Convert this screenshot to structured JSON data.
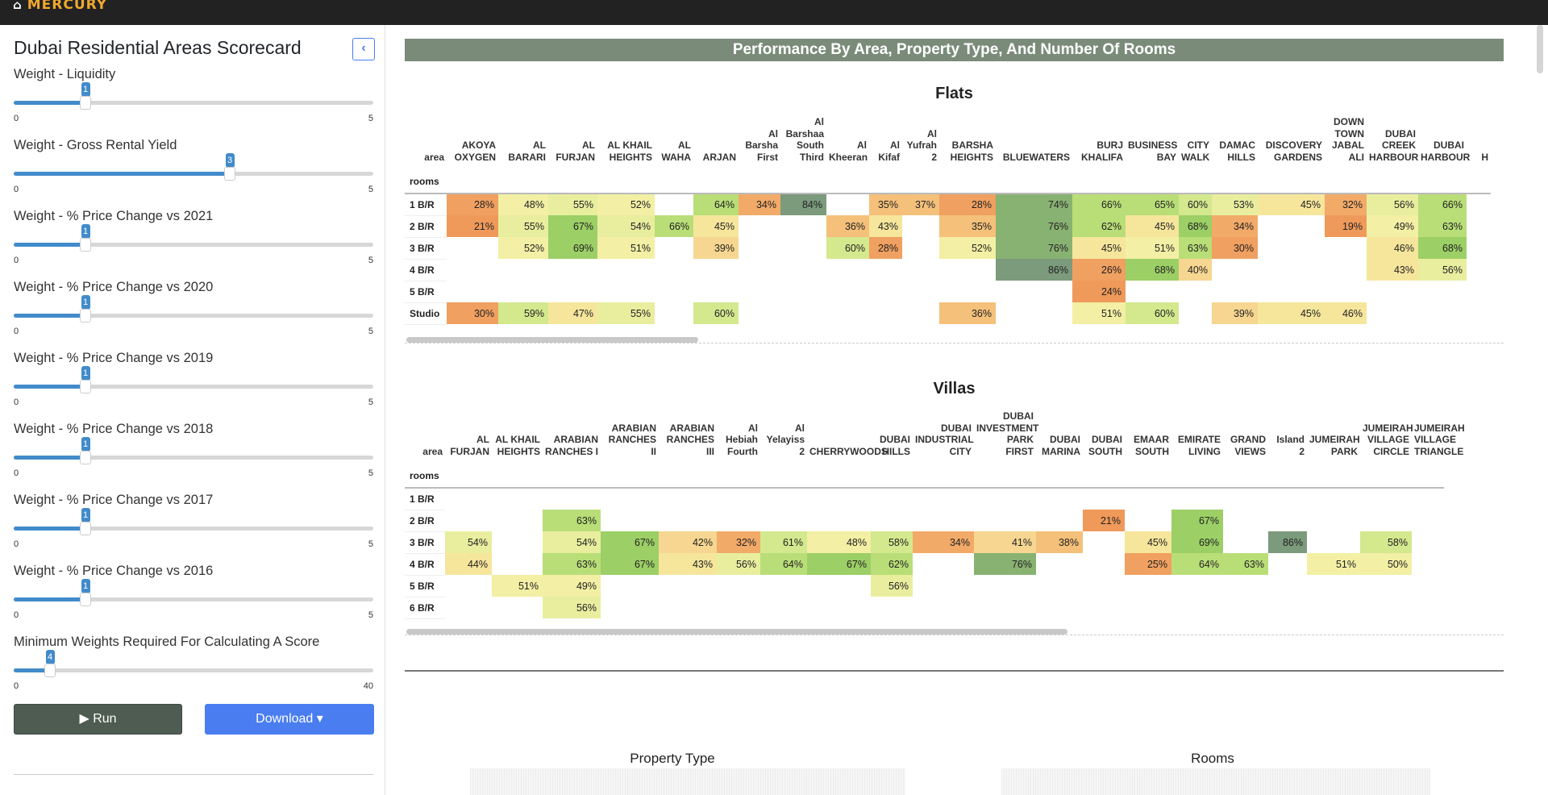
{
  "brand": {
    "name": "MERCURY",
    "home_icon": "home-icon"
  },
  "sidebar": {
    "title": "Dubai Residential Areas Scorecard",
    "collapse_icon": "chevron-left-icon",
    "sliders": [
      {
        "label": "Weight - Liquidity",
        "value": 1,
        "min": "0",
        "max": "5"
      },
      {
        "label": "Weight - Gross Rental Yield",
        "value": 3,
        "min": "0",
        "max": "5"
      },
      {
        "label": "Weight - % Price Change vs 2021",
        "value": 1,
        "min": "0",
        "max": "5"
      },
      {
        "label": "Weight - % Price Change vs 2020",
        "value": 1,
        "min": "0",
        "max": "5"
      },
      {
        "label": "Weight - % Price Change vs 2019",
        "value": 1,
        "min": "0",
        "max": "5"
      },
      {
        "label": "Weight - % Price Change vs 2018",
        "value": 1,
        "min": "0",
        "max": "5"
      },
      {
        "label": "Weight - % Price Change vs 2017",
        "value": 1,
        "min": "0",
        "max": "5"
      },
      {
        "label": "Weight - % Price Change vs 2016",
        "value": 1,
        "min": "0",
        "max": "5"
      },
      {
        "label": "Minimum Weights Required For Calculating A Score",
        "value": 4,
        "min": "0",
        "max": "40"
      }
    ],
    "run_label": "▶ Run",
    "download_label": "Download ▾"
  },
  "main": {
    "banner": "Performance By Area, Property Type, And Number Of Rooms",
    "flats": {
      "title": "Flats",
      "area_label": "area",
      "rooms_label": "rooms",
      "areas": [
        "AKOYA OXYGEN",
        "AL BARARI",
        "AL FURJAN",
        "AL KHAIL HEIGHTS",
        "AL WAHA",
        "ARJAN",
        "Al Barsha First",
        "Al Barshaa South Third",
        "Al Kheeran",
        "Al Kifaf",
        "Al Yufrah 2",
        "BARSHA HEIGHTS",
        "BLUEWATERS",
        "BURJ KHALIFA",
        "BUSINESS BAY",
        "CITY WALK",
        "DAMAC HILLS",
        "DISCOVERY GARDENS",
        "DOWN TOWN JABAL ALI",
        "DUBAI CREEK HARBOUR",
        "DUBAI HARBOUR",
        "H"
      ],
      "rows": [
        {
          "room": "1 B/R",
          "cells": [
            "28%",
            "48%",
            "55%",
            "52%",
            "",
            "64%",
            "34%",
            "84%",
            "",
            "35%",
            "37%",
            "28%",
            "74%",
            "66%",
            "65%",
            "60%",
            "53%",
            "45%",
            "32%",
            "56%",
            "66%",
            ""
          ]
        },
        {
          "room": "2 B/R",
          "cells": [
            "21%",
            "55%",
            "67%",
            "54%",
            "66%",
            "45%",
            "",
            "",
            "36%",
            "43%",
            "",
            "35%",
            "76%",
            "62%",
            "45%",
            "68%",
            "34%",
            "",
            "19%",
            "49%",
            "63%",
            ""
          ]
        },
        {
          "room": "3 B/R",
          "cells": [
            "",
            "52%",
            "69%",
            "51%",
            "",
            "39%",
            "",
            "",
            "60%",
            "28%",
            "",
            "52%",
            "76%",
            "45%",
            "51%",
            "63%",
            "30%",
            "",
            "",
            "46%",
            "68%",
            ""
          ]
        },
        {
          "room": "4 B/R",
          "cells": [
            "",
            "",
            "",
            "",
            "",
            "",
            "",
            "",
            "",
            "",
            "",
            "",
            "86%",
            "26%",
            "68%",
            "40%",
            "",
            "",
            "",
            "43%",
            "56%",
            ""
          ]
        },
        {
          "room": "5 B/R",
          "cells": [
            "",
            "",
            "",
            "",
            "",
            "",
            "",
            "",
            "",
            "",
            "",
            "",
            "",
            "24%",
            "",
            "",
            "",
            "",
            "",
            "",
            "",
            ""
          ]
        },
        {
          "room": "Studio",
          "cells": [
            "30%",
            "59%",
            "47%",
            "55%",
            "",
            "60%",
            "",
            "",
            "",
            "",
            "",
            "36%",
            "",
            "51%",
            "60%",
            "",
            "39%",
            "45%",
            "46%",
            "",
            "",
            ""
          ]
        }
      ]
    },
    "villas": {
      "title": "Villas",
      "area_label": "area",
      "rooms_label": "rooms",
      "areas": [
        "AL FURJAN",
        "AL KHAIL HEIGHTS",
        "ARABIAN RANCHES I",
        "ARABIAN RANCHES II",
        "ARABIAN RANCHES III",
        "Al Hebiah Fourth",
        "Al Yelayiss 2",
        "CHERRYWOODS",
        "DUBAI HILLS",
        "DUBAI INDUSTRIAL CITY",
        "DUBAI INVESTMENT PARK FIRST",
        "DUBAI MARINA",
        "DUBAI SOUTH",
        "EMAAR SOUTH",
        "EMIRATE LIVING",
        "GRAND VIEWS",
        "Island 2",
        "JUMEIRAH PARK",
        "JUMEIRAH VILLAGE CIRCLE",
        "JUMEIRAH VILLAGE TRIANGLE"
      ],
      "rows": [
        {
          "room": "1 B/R",
          "cells": [
            "",
            "",
            "",
            "",
            "",
            "",
            "",
            "",
            "",
            "",
            "",
            "",
            "",
            "",
            "",
            "",
            "",
            "",
            "",
            ""
          ]
        },
        {
          "room": "2 B/R",
          "cells": [
            "",
            "",
            "63%",
            "",
            "",
            "",
            "",
            "",
            "",
            "",
            "",
            "",
            "21%",
            "",
            "67%",
            "",
            "",
            "",
            "",
            ""
          ]
        },
        {
          "room": "3 B/R",
          "cells": [
            "54%",
            "",
            "54%",
            "67%",
            "42%",
            "32%",
            "61%",
            "48%",
            "58%",
            "34%",
            "41%",
            "38%",
            "",
            "45%",
            "69%",
            "",
            "86%",
            "",
            "58%",
            ""
          ]
        },
        {
          "room": "4 B/R",
          "cells": [
            "44%",
            "",
            "63%",
            "67%",
            "43%",
            "56%",
            "64%",
            "67%",
            "62%",
            "",
            "76%",
            "",
            "",
            "25%",
            "64%",
            "63%",
            "",
            "51%",
            "50%",
            ""
          ]
        },
        {
          "room": "5 B/R",
          "cells": [
            "",
            "51%",
            "49%",
            "",
            "",
            "",
            "",
            "",
            "56%",
            "",
            "",
            "",
            "",
            "",
            "",
            "",
            "",
            "",
            "",
            ""
          ]
        },
        {
          "room": "6 B/R",
          "cells": [
            "",
            "",
            "56%",
            "",
            "",
            "",
            "",
            "",
            "",
            "",
            "",
            "",
            "",
            "",
            "",
            "",
            "",
            "",
            "",
            ""
          ]
        }
      ]
    },
    "charts": {
      "property_type_title": "Property Type",
      "rooms_title": "Rooms"
    }
  },
  "colors": {
    "c21": "#ef9a5a",
    "c28": "#f0a060",
    "c32": "#f2aa68",
    "c36": "#f4c07a",
    "c40": "#f6d690",
    "c45": "#f6e69c",
    "c50": "#f3efa4",
    "c55": "#e8ee9e",
    "c60": "#d4e88e",
    "c65": "#b9de78",
    "c70": "#9ccf66",
    "c75": "#88b272",
    "c80": "#7c9a7c"
  }
}
